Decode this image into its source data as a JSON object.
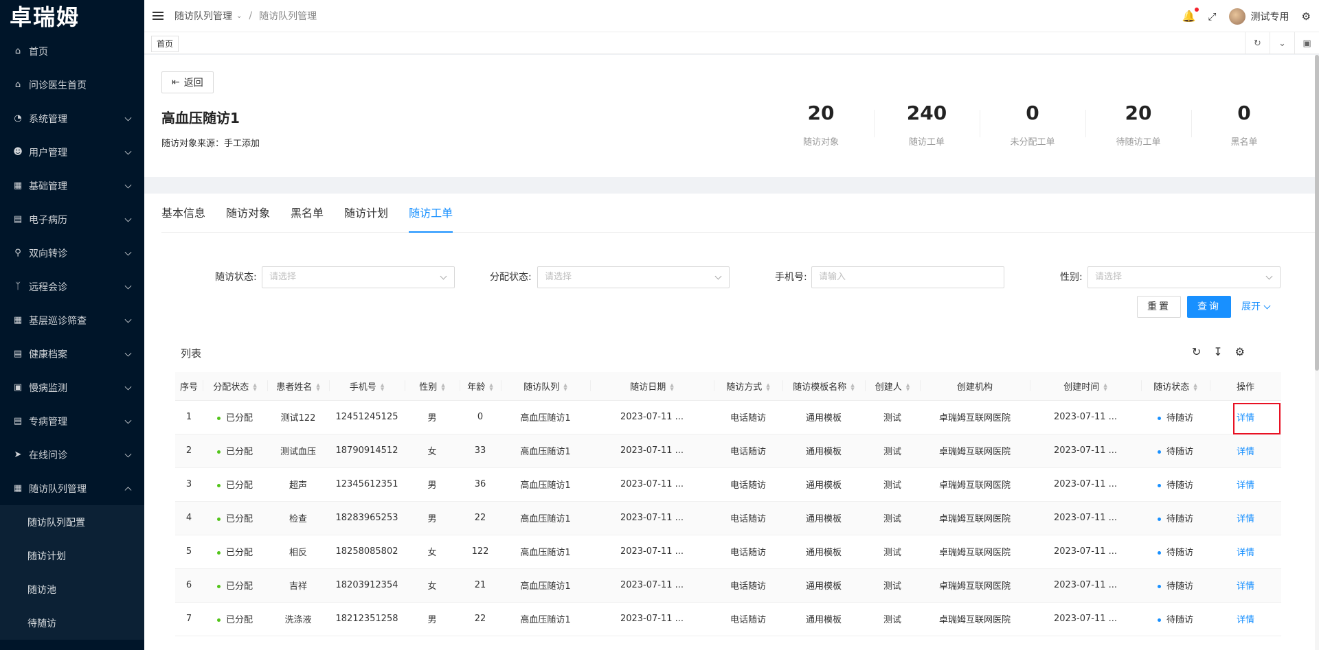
{
  "app": {
    "logo": "卓瑞姆"
  },
  "sidebar": {
    "items": [
      {
        "label": "首页",
        "icon": "home-icon"
      },
      {
        "label": "问诊医生首页",
        "icon": "home-icon"
      },
      {
        "label": "系统管理",
        "icon": "dashboard-icon"
      },
      {
        "label": "用户管理",
        "icon": "user-icon"
      },
      {
        "label": "基础管理",
        "icon": "grid-icon"
      },
      {
        "label": "电子病历",
        "icon": "record-icon"
      },
      {
        "label": "双向转诊",
        "icon": "cluster-icon"
      },
      {
        "label": "远程会诊",
        "icon": "branch-icon"
      },
      {
        "label": "基层巡诊筛查",
        "icon": "grid-icon"
      },
      {
        "label": "健康档案",
        "icon": "record-icon"
      },
      {
        "label": "慢病监测",
        "icon": "monitor-icon"
      },
      {
        "label": "专病管理",
        "icon": "record-icon"
      },
      {
        "label": "在线问诊",
        "icon": "send-icon"
      },
      {
        "label": "随访队列管理",
        "icon": "apps-icon"
      }
    ],
    "submenu": [
      {
        "label": "随访队列配置"
      },
      {
        "label": "随访计划"
      },
      {
        "label": "随访池"
      },
      {
        "label": "待随访"
      }
    ]
  },
  "header": {
    "breadcrumb_parent": "随访队列管理",
    "breadcrumb_current": "随访队列管理",
    "user_name": "测试专用"
  },
  "tabsbar": {
    "tag": "首页"
  },
  "queue": {
    "back_label": "返回",
    "title": "高血压随访1",
    "source_label": "随访对象来源：手工添加"
  },
  "stats": [
    {
      "value": "20",
      "label": "随访对象"
    },
    {
      "value": "240",
      "label": "随访工单"
    },
    {
      "value": "0",
      "label": "未分配工单"
    },
    {
      "value": "20",
      "label": "待随访工单"
    },
    {
      "value": "0",
      "label": "黑名单"
    }
  ],
  "tabs": [
    {
      "label": "基本信息"
    },
    {
      "label": "随访对象"
    },
    {
      "label": "黑名单"
    },
    {
      "label": "随访计划"
    },
    {
      "label": "随访工单"
    }
  ],
  "filters": {
    "follow_status_label": "随访状态:",
    "follow_status_placeholder": "请选择",
    "assign_status_label": "分配状态:",
    "assign_status_placeholder": "请选择",
    "phone_label": "手机号:",
    "phone_placeholder": "请输入",
    "gender_label": "性别:",
    "gender_placeholder": "请选择",
    "reset_label": "重置",
    "query_label": "查询",
    "expand_label": "展开"
  },
  "list": {
    "title": "列表",
    "columns": [
      "序号",
      "分配状态",
      "患者姓名",
      "手机号",
      "性别",
      "年龄",
      "随访队列",
      "随访日期",
      "随访方式",
      "随访模板名称",
      "创建人",
      "创建机构",
      "创建时间",
      "随访状态",
      "操作"
    ],
    "rows": [
      {
        "no": "1",
        "assign": "已分配",
        "name": "测试122",
        "phone": "12451245125",
        "gender": "男",
        "age": "0",
        "queue": "高血压随访1",
        "date": "2023-07-11 ...",
        "method": "电话随访",
        "template": "通用模板",
        "creator": "测试",
        "org": "卓瑞姆互联网医院",
        "created": "2023-07-11 ...",
        "status": "待随访",
        "action": "详情"
      },
      {
        "no": "2",
        "assign": "已分配",
        "name": "测试血压",
        "phone": "18790914512",
        "gender": "女",
        "age": "33",
        "queue": "高血压随访1",
        "date": "2023-07-11 ...",
        "method": "电话随访",
        "template": "通用模板",
        "creator": "测试",
        "org": "卓瑞姆互联网医院",
        "created": "2023-07-11 ...",
        "status": "待随访",
        "action": "详情"
      },
      {
        "no": "3",
        "assign": "已分配",
        "name": "超声",
        "phone": "12345612351",
        "gender": "男",
        "age": "36",
        "queue": "高血压随访1",
        "date": "2023-07-11 ...",
        "method": "电话随访",
        "template": "通用模板",
        "creator": "测试",
        "org": "卓瑞姆互联网医院",
        "created": "2023-07-11 ...",
        "status": "待随访",
        "action": "详情"
      },
      {
        "no": "4",
        "assign": "已分配",
        "name": "检查",
        "phone": "18283965253",
        "gender": "男",
        "age": "22",
        "queue": "高血压随访1",
        "date": "2023-07-11 ...",
        "method": "电话随访",
        "template": "通用模板",
        "creator": "测试",
        "org": "卓瑞姆互联网医院",
        "created": "2023-07-11 ...",
        "status": "待随访",
        "action": "详情"
      },
      {
        "no": "5",
        "assign": "已分配",
        "name": "相反",
        "phone": "18258085802",
        "gender": "女",
        "age": "122",
        "queue": "高血压随访1",
        "date": "2023-07-11 ...",
        "method": "电话随访",
        "template": "通用模板",
        "creator": "测试",
        "org": "卓瑞姆互联网医院",
        "created": "2023-07-11 ...",
        "status": "待随访",
        "action": "详情"
      },
      {
        "no": "6",
        "assign": "已分配",
        "name": "吉祥",
        "phone": "18203912354",
        "gender": "女",
        "age": "21",
        "queue": "高血压随访1",
        "date": "2023-07-11 ...",
        "method": "电话随访",
        "template": "通用模板",
        "creator": "测试",
        "org": "卓瑞姆互联网医院",
        "created": "2023-07-11 ...",
        "status": "待随访",
        "action": "详情"
      },
      {
        "no": "7",
        "assign": "已分配",
        "name": "洗涤液",
        "phone": "18212351258",
        "gender": "男",
        "age": "22",
        "queue": "高血压随访1",
        "date": "2023-07-11 ...",
        "method": "电话随访",
        "template": "通用模板",
        "creator": "测试",
        "org": "卓瑞姆互联网医院",
        "created": "2023-07-11 ...",
        "status": "待随访",
        "action": "详情"
      }
    ]
  },
  "colors": {
    "accent": "#1890ff",
    "sidebar_bg": "#001529",
    "assigned_dot": "#52c41a",
    "highlight_border": "#e81123"
  }
}
